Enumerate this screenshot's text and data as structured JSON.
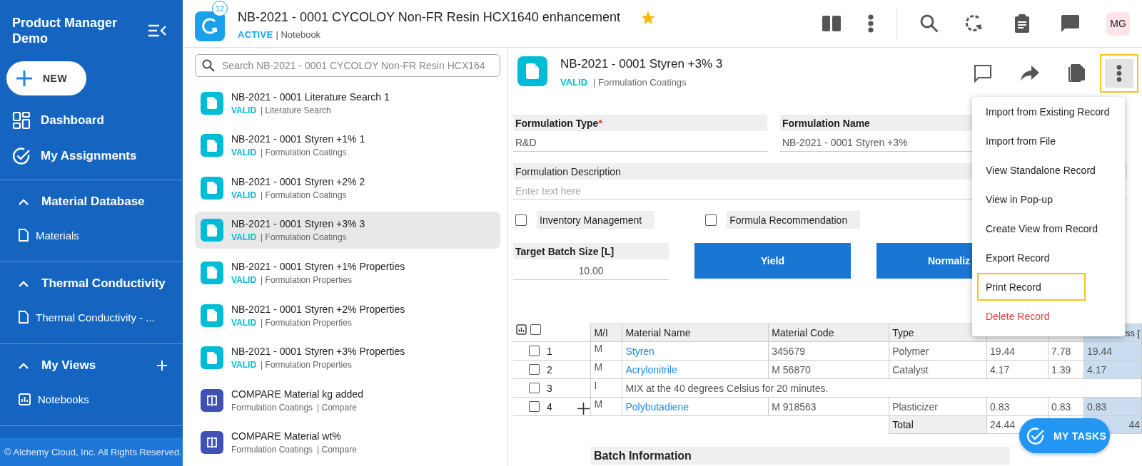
{
  "sidebar": {
    "title": "Product Manager Demo",
    "new_button": "NEW",
    "nav": [
      {
        "label": "Dashboard",
        "kind": "dashboard"
      },
      {
        "label": "My Assignments",
        "kind": "assignments"
      }
    ],
    "sections": [
      {
        "title": "Material Database",
        "expanded": true,
        "can_add": false,
        "items": [
          {
            "label": "Materials",
            "kind": "document"
          }
        ]
      },
      {
        "title": "Thermal Conductivity",
        "expanded": true,
        "can_add": false,
        "items": [
          {
            "label": "Thermal Conductivity - ...",
            "kind": "document"
          }
        ]
      },
      {
        "title": "My Views",
        "expanded": true,
        "can_add": true,
        "items": [
          {
            "label": "Notebooks",
            "kind": "chart"
          }
        ]
      }
    ],
    "footer": "© Alchemy Cloud, Inc. All Rights Reserved."
  },
  "header": {
    "badge": "12",
    "title": "NB-2021 - 0001 CYCOLOY Non-FR Resin HCX1640 enhancement",
    "favorite": true,
    "status": "ACTIVE",
    "type": "| Notebook",
    "avatar": "MG"
  },
  "list": {
    "search_placeholder": "Search NB-2021 - 0001 CYCOLOY Non-FR Resin HCX164",
    "items": [
      {
        "kind": "record",
        "title": "NB-2021 - 0001 Literature Search 1",
        "status": "VALID",
        "category": "| Literature Search",
        "selected": false
      },
      {
        "kind": "record",
        "title": "NB-2021 - 0001 Styren +1% 1",
        "status": "VALID",
        "category": "| Formulation Coatings",
        "selected": false
      },
      {
        "kind": "record",
        "title": "NB-2021 - 0001 Styren +2% 2",
        "status": "VALID",
        "category": "| Formulation Coatings",
        "selected": false
      },
      {
        "kind": "record",
        "title": "NB-2021 - 0001 Styren +3% 3",
        "status": "VALID",
        "category": "| Formulation Coatings",
        "selected": true
      },
      {
        "kind": "record",
        "title": "NB-2021 - 0001 Styren +1% Properties",
        "status": "VALID",
        "category": "| Formulation Properties",
        "selected": false
      },
      {
        "kind": "record",
        "title": "NB-2021 - 0001 Styren +2% Properties",
        "status": "VALID",
        "category": "| Formulation Properties",
        "selected": false
      },
      {
        "kind": "record",
        "title": "NB-2021 - 0001 Styren +3% Properties",
        "status": "VALID",
        "category": "| Formulation Properties",
        "selected": false
      },
      {
        "kind": "compare",
        "title": "COMPARE Material kg added",
        "category": "Formulation Coatings",
        "type": "| Compare",
        "selected": false
      },
      {
        "kind": "compare",
        "title": "COMPARE Material wt%",
        "category": "Formulation Coatings",
        "type": "| Compare",
        "selected": false
      }
    ]
  },
  "detail": {
    "title": "NB-2021 - 0001 Styren +3% 3",
    "status": "VALID",
    "category": "| Formulation Coatings",
    "actions": [
      {
        "kind": "comment",
        "highlighted": false
      },
      {
        "kind": "share",
        "highlighted": false
      },
      {
        "kind": "copy",
        "highlighted": false
      },
      {
        "kind": "more",
        "highlighted": true
      }
    ],
    "fields": [
      {
        "label": "Formulation Type",
        "required_mark": "*",
        "value": "R&D"
      },
      {
        "label": "Formulation Name",
        "value": "NB-2021 - 0001 Styren +3%"
      }
    ],
    "description": {
      "label": "Formulation Description",
      "placeholder": "Enter text here"
    },
    "checkboxes": [
      {
        "label": "Inventory Management",
        "checked": false
      },
      {
        "label": "Formula Recommendation",
        "checked": false
      }
    ],
    "batch": {
      "label": "Target Batch Size [L]",
      "value": "10.00"
    },
    "buttons": [
      "Yield",
      "Normaliz"
    ],
    "table": {
      "select_all_checked": false,
      "columns": [
        {
          "label": "M/I",
          "highlighted": false
        },
        {
          "label": "Material Name",
          "highlighted": false
        },
        {
          "label": "Material Code",
          "highlighted": false
        },
        {
          "label": "Type",
          "highlighted": false
        },
        {
          "highlighted": false
        },
        {
          "highlighted": false
        },
        {
          "label": "ss [",
          "highlighted": true
        }
      ],
      "rows": [
        {
          "kind": "material",
          "number": "1",
          "checked": false,
          "add_handle": false,
          "cells": [
            "M",
            "Styren",
            "345679",
            "Polymer",
            "19.44",
            "7.78",
            "19.44"
          ]
        },
        {
          "kind": "material",
          "number": "2",
          "checked": false,
          "add_handle": false,
          "cells": [
            "M",
            "Acrylonitrile",
            "M 56870",
            "Catalyst",
            "4.17",
            "1.39",
            "4.17"
          ]
        },
        {
          "kind": "instruction",
          "number": "3",
          "checked": false,
          "add_handle": false,
          "cells": [
            "I",
            {
              "text": "MIX at the 40 degrees Celsius for 20 minutes.",
              "colspan": 6
            }
          ]
        },
        {
          "kind": "material",
          "number": "4",
          "checked": false,
          "add_handle": true,
          "cells": [
            "M",
            "Polybutadiene",
            "M 918563",
            "Plasticizer",
            "0.83",
            "0.83",
            "0.83"
          ]
        }
      ],
      "total": {
        "label": "Total",
        "cells": [
          "24.44",
          null,
          "44"
        ]
      }
    },
    "section": "Batch Information"
  },
  "menu": {
    "items": [
      {
        "label": "Import from Existing Record",
        "kind": "normal",
        "highlighted": false
      },
      {
        "label": "Import from File",
        "kind": "normal",
        "highlighted": false
      },
      {
        "label": "View Standalone Record",
        "kind": "normal",
        "highlighted": false
      },
      {
        "label": "View in Pop-up",
        "kind": "normal",
        "highlighted": false
      },
      {
        "label": "Create View from Record",
        "kind": "normal",
        "highlighted": false
      },
      {
        "label": "Export Record",
        "kind": "normal",
        "highlighted": false
      },
      {
        "label": "Print Record",
        "kind": "normal",
        "highlighted": true
      },
      {
        "label": "Delete Record",
        "kind": "danger",
        "highlighted": false
      }
    ]
  },
  "fab": "MY TASKS"
}
